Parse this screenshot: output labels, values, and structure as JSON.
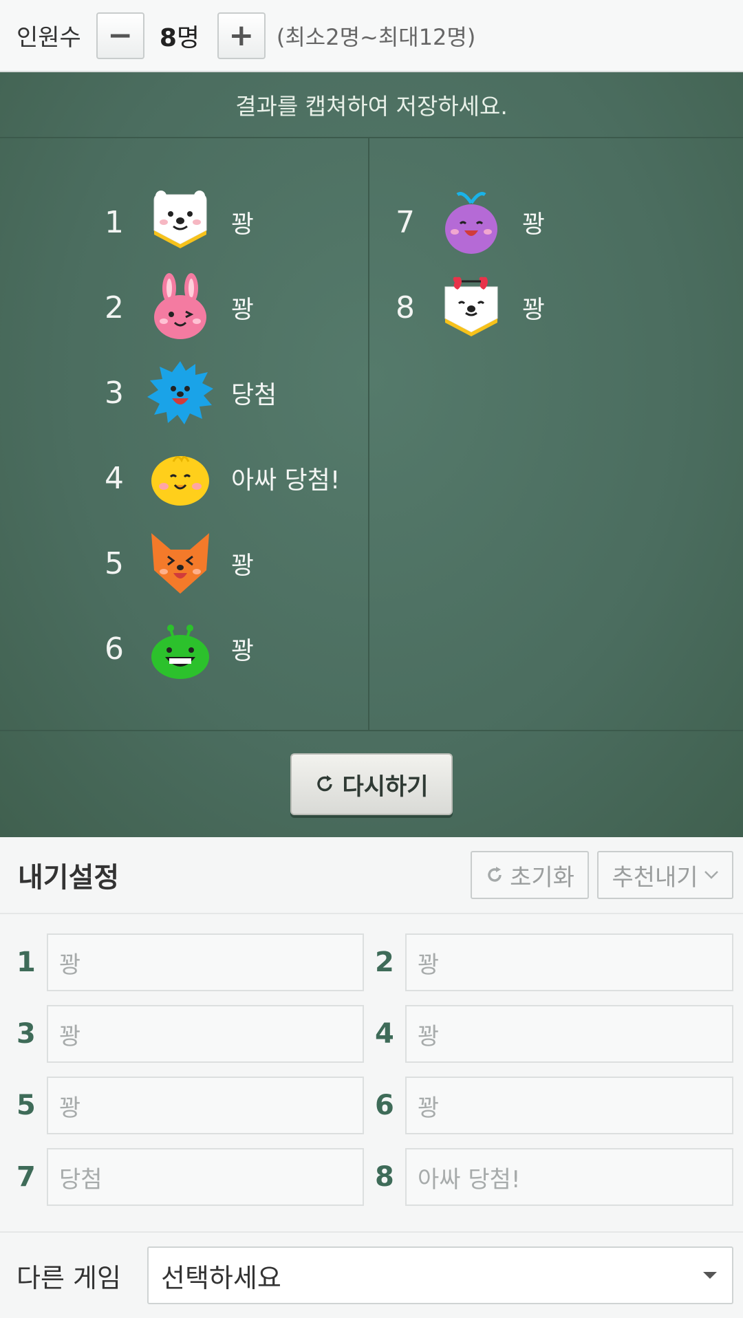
{
  "top": {
    "label": "인원수",
    "minus": "−",
    "plus": "+",
    "count": "8",
    "unit": "명",
    "range": "(최소2명~최대12명)"
  },
  "board": {
    "header": "결과를 캡쳐하여 저장하세요.",
    "results_left": [
      {
        "num": "1",
        "character": "white-bear",
        "text": "꽝"
      },
      {
        "num": "2",
        "character": "pink-rabbit",
        "text": "꽝"
      },
      {
        "num": "3",
        "character": "blue-hedgehog",
        "text": "당첨"
      },
      {
        "num": "4",
        "character": "yellow-chick",
        "text": "아싸 당첨!"
      },
      {
        "num": "5",
        "character": "orange-fox",
        "text": "꽝"
      },
      {
        "num": "6",
        "character": "green-frog",
        "text": "꽝"
      }
    ],
    "results_right": [
      {
        "num": "7",
        "character": "purple-whale",
        "text": "꽝"
      },
      {
        "num": "8",
        "character": "sunglasses-puppy",
        "text": "꽝"
      }
    ],
    "retry_label": "다시하기"
  },
  "settings": {
    "title": "내기설정",
    "reset_label": "초기화",
    "recommend_label": "추천내기",
    "items": [
      {
        "num": "1",
        "value": "꽝"
      },
      {
        "num": "2",
        "value": "꽝"
      },
      {
        "num": "3",
        "value": "꽝"
      },
      {
        "num": "4",
        "value": "꽝"
      },
      {
        "num": "5",
        "value": "꽝"
      },
      {
        "num": "6",
        "value": "꽝"
      },
      {
        "num": "7",
        "value": "당첨"
      },
      {
        "num": "8",
        "value": "아싸 당첨!"
      }
    ]
  },
  "other_game": {
    "label": "다른 게임",
    "selected": "선택하세요"
  },
  "colors": {
    "board": "#4b6d5f",
    "accent_number": "#3e6b58"
  }
}
